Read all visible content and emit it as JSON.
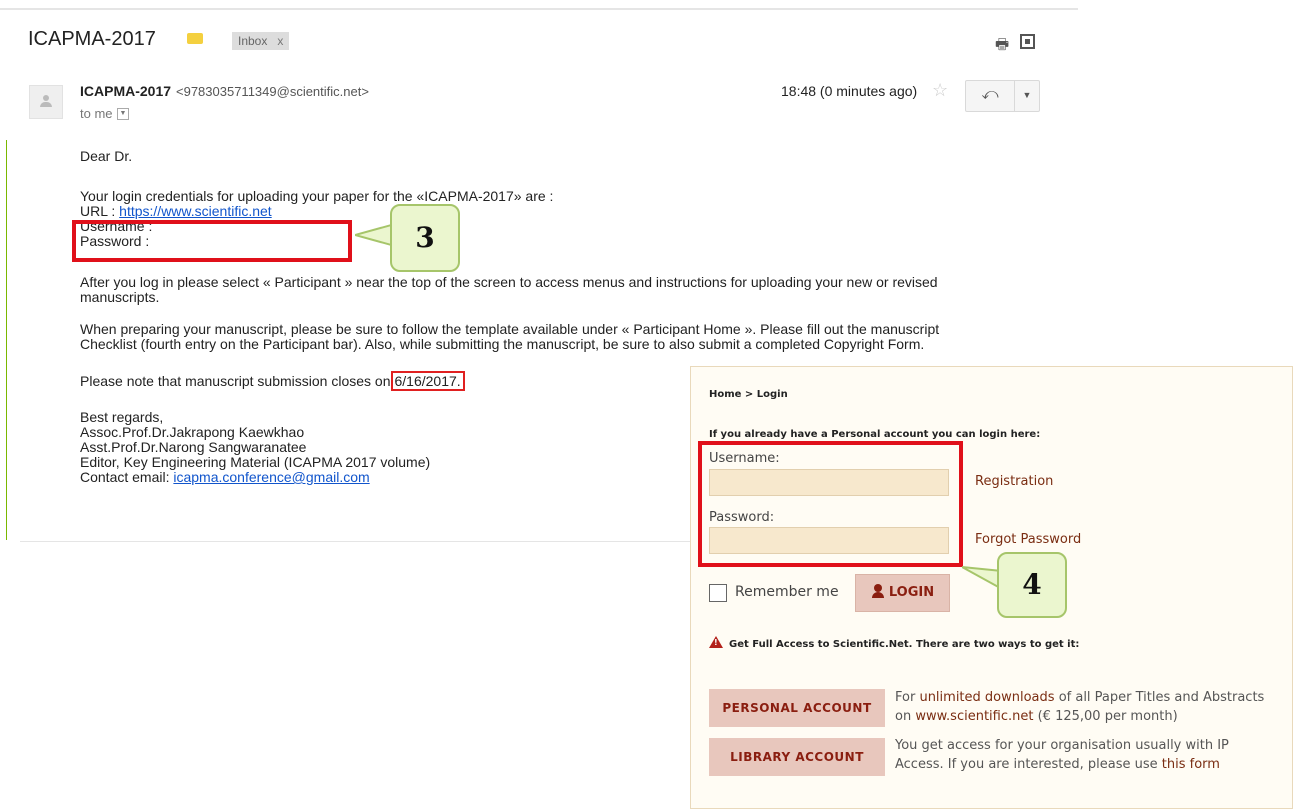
{
  "email": {
    "subject": "ICAPMA-2017",
    "inbox_chip": "Inbox",
    "inbox_chip_close": "x",
    "sender_name": "ICAPMA-2017",
    "sender_email": "<9783035711349@scientific.net>",
    "to": "to me",
    "timestamp": "18:48 (0 minutes ago)",
    "greeting": "Dear Dr.",
    "credentials_intro": "Your login credentials for uploading your paper for the «ICAPMA-2017» are :",
    "url_label": "URL :",
    "url_link": "https://www.scientific.net",
    "username_label": "Username :",
    "password_label": "Password :",
    "after_login_1": "After you log in please select « Participant » near the top of the screen to access menus and instructions for uploading your new or revised",
    "after_login_2": "manuscripts.",
    "preparing_1": "When preparing your manuscript, please be sure to follow the template available under « Participant Home ». Please fill out the manuscript",
    "preparing_2": "Checklist (fourth entry on the Participant bar). Also, while submitting the manuscript, be sure to also submit a completed Copyright Form.",
    "deadline_text": "Please note that manuscript submission closes on",
    "deadline_date": "6/16/2017.",
    "regards": "Best regards,",
    "signer_1": "Assoc.Prof.Dr.Jakrapong Kaewkhao",
    "signer_2": "Asst.Prof.Dr.Narong Sangwaranatee",
    "signer_3": "Editor, Key Engineering Material (ICAPMA 2017 volume)",
    "contact_label": "Contact email:",
    "contact_email": "icapma.conference@gmail.com"
  },
  "callouts": {
    "first": "3",
    "second": "4"
  },
  "login": {
    "breadcrumb": "Home > Login",
    "intro": "If you already have a Personal account you can login here:",
    "username_label": "Username:",
    "password_label": "Password:",
    "registration_link": "Registration",
    "forgot_link": "Forgot Password",
    "remember_label": "Remember me",
    "login_button": "LOGIN",
    "full_access": "Get Full Access to Scientific.Net. There are two ways to get it:",
    "personal_button": "PERSONAL ACCOUNT",
    "personal_text_pre": "For",
    "personal_text_link": "unlimited downloads",
    "personal_text_mid": "of all Paper Titles and Abstracts on",
    "personal_text_site": "www.scientific.net",
    "personal_text_post": "(€ 125,00 per month)",
    "library_button": "LIBRARY ACCOUNT",
    "library_text_pre": "You get access for your organisation usually with IP Access. If you are interested, please use",
    "library_text_link": "this form"
  },
  "colors": {
    "highlight_red": "#e0101a",
    "callout_fill": "#ebf6cf",
    "brand_maroon": "#8a1e10",
    "link_blue": "#1155cc"
  },
  "icons": [
    "label-tag-icon",
    "print-icon",
    "new-window-icon",
    "avatar",
    "dropdown-icon",
    "star-icon",
    "reply-icon",
    "more-icon",
    "user-icon",
    "warning-icon"
  ]
}
